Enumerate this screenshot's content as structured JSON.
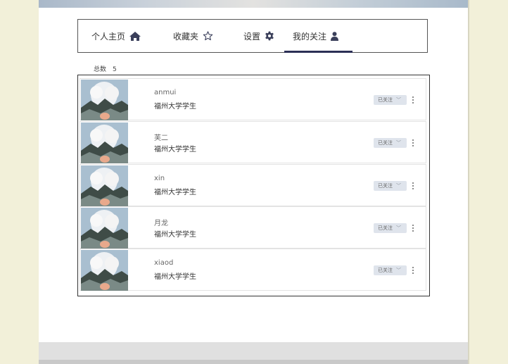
{
  "nav": {
    "items": [
      {
        "label": "个人主页",
        "icon": "home-icon"
      },
      {
        "label": "收藏夹",
        "icon": "star-icon"
      },
      {
        "label": "设置",
        "icon": "gear-icon"
      },
      {
        "label": "我的关注",
        "icon": "user-icon",
        "active": true
      }
    ],
    "active_color": "#2b2f55"
  },
  "summary": {
    "total_label": "总数",
    "total_count": "5"
  },
  "follow_list": [
    {
      "name": "anmui",
      "school": "福州大学学生",
      "status": "已关注"
    },
    {
      "name": "芙二",
      "school": "福州大学学生",
      "status": "已关注"
    },
    {
      "name": "xin",
      "school": "福州大学学生",
      "status": "已关注"
    },
    {
      "name": "月龙",
      "school": "福州大学学生",
      "status": "已关注"
    },
    {
      "name": "xiaod",
      "school": "福州大学学生",
      "status": "已关注"
    }
  ],
  "colors": {
    "page_bg": "#f2f0d9",
    "button_bg": "#dfe4ec",
    "border": "#333333"
  }
}
